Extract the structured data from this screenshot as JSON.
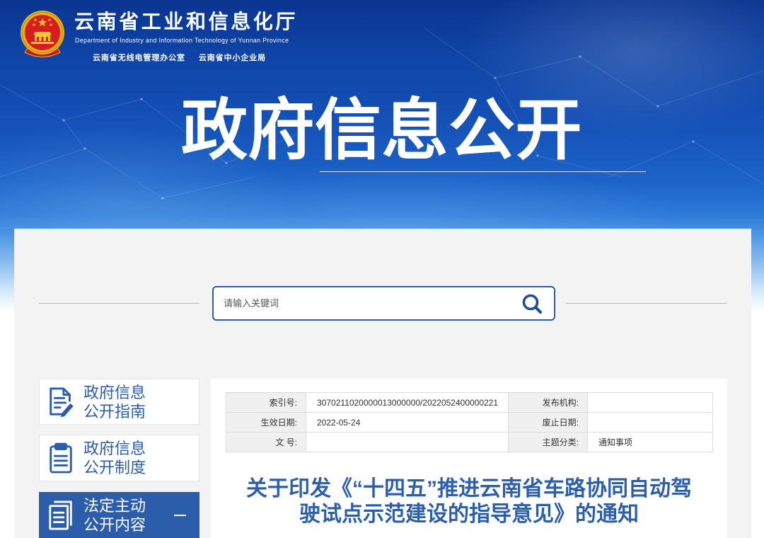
{
  "theme": {
    "banner_top": "#0a3590",
    "primary_blue": "#2b5dab",
    "title_blue": "#2c5eab",
    "panel_bg": "#f3f3f3"
  },
  "header": {
    "emblem_icon": "national-emblem-icon",
    "org_name_cn": "云南省工业和信息化厅",
    "org_name_en": "Department of Industry and Information Technology of Yunnan Province",
    "sub_orgs": [
      "云南省无线电管理办公室",
      "云南省中小企业局"
    ]
  },
  "banner": {
    "title": "政府信息公开"
  },
  "search": {
    "placeholder": "请输入关键词",
    "button_icon": "search-icon"
  },
  "sidebar": {
    "items": [
      {
        "lines": [
          "政府信息",
          "公开指南"
        ],
        "icon": "document-edit-icon",
        "active": false
      },
      {
        "lines": [
          "政府信息",
          "公开制度"
        ],
        "icon": "clipboard-icon",
        "active": false
      },
      {
        "lines": [
          "法定主动",
          "公开内容"
        ],
        "icon": "documents-icon",
        "active": true,
        "toggle_icon": "minus-icon"
      }
    ]
  },
  "article": {
    "meta": {
      "rows": [
        [
          {
            "label": "索引号:",
            "value": "3070211020000013000000/2022052400000221"
          },
          {
            "label": "发布机构:",
            "value": ""
          }
        ],
        [
          {
            "label": "生效日期:",
            "value": "2022-05-24"
          },
          {
            "label": "废止日期:",
            "value": ""
          }
        ],
        [
          {
            "label": "文 号:",
            "value": ""
          },
          {
            "label": "主题分类:",
            "value": "通知事项"
          }
        ]
      ]
    },
    "title_lines": [
      "关于印发《“十四五”推进云南省车路协同自动驾",
      "驶试点示范建设的指导意见》的通知"
    ]
  }
}
